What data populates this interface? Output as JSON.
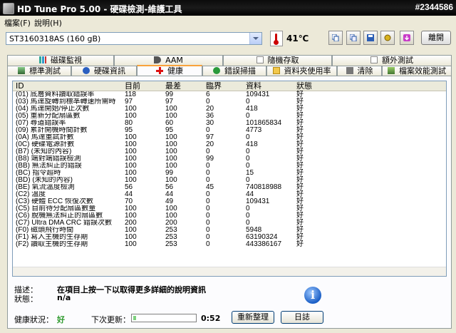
{
  "window": {
    "title": "HD Tune Pro  5.00 - 硬碟檢測-維護工具",
    "watermark": "#2344586"
  },
  "menu": [
    {
      "label": "檔案(F)"
    },
    {
      "label": "說明(H)"
    }
  ],
  "toolbar": {
    "drive": "ST3160318AS (160 gB)",
    "temperature": "41℃",
    "exit_label": "離開"
  },
  "tabs_top": [
    {
      "label": "磁碟監視"
    },
    {
      "label": "AAM"
    },
    {
      "label": "隨機存取"
    },
    {
      "label": "額外測試"
    }
  ],
  "tabs_bottom": [
    {
      "label": "標準測試"
    },
    {
      "label": "硬碟資訊"
    },
    {
      "label": "健康"
    },
    {
      "label": "錯誤掃描"
    },
    {
      "label": "資料夾使用率"
    },
    {
      "label": "清除"
    },
    {
      "label": "檔案效能測試"
    }
  ],
  "table": {
    "headers": [
      "ID",
      "目前",
      "最差",
      "臨界",
      "資料",
      "狀態"
    ],
    "rows": [
      [
        "(01) 底層資料讀取錯誤率",
        "118",
        "99",
        "6",
        "109431",
        "好"
      ],
      [
        "(03) 馬達旋轉到標準轉速所需時…",
        "97",
        "97",
        "0",
        "0",
        "好"
      ],
      [
        "(04) 馬達開始/停止次數",
        "100",
        "100",
        "20",
        "418",
        "好"
      ],
      [
        "(05) 重新分配扇區數",
        "100",
        "100",
        "36",
        "0",
        "好"
      ],
      [
        "(07) 尋道錯誤率",
        "80",
        "60",
        "30",
        "101865834",
        "好"
      ],
      [
        "(09) 累計開機時間計數",
        "95",
        "95",
        "0",
        "4773",
        "好"
      ],
      [
        "(0A) 馬達重試計數",
        "100",
        "100",
        "97",
        "0",
        "好"
      ],
      [
        "(0C) 硬碟電源計數",
        "100",
        "100",
        "20",
        "418",
        "好"
      ],
      [
        "(B7) (未知的內容)",
        "100",
        "100",
        "0",
        "0",
        "好"
      ],
      [
        "(B8) 端對端錯誤檢測",
        "100",
        "100",
        "99",
        "0",
        "好"
      ],
      [
        "(BB) 無法糾正的錯誤",
        "100",
        "100",
        "0",
        "0",
        "好"
      ],
      [
        "(BC) 指令超時",
        "100",
        "99",
        "0",
        "15",
        "好"
      ],
      [
        "(BD) (未知的內容)",
        "100",
        "100",
        "0",
        "0",
        "好"
      ],
      [
        "(BE) 氣流溫度檢測",
        "56",
        "56",
        "45",
        "740818988",
        "好"
      ],
      [
        "(C2) 溫度",
        "44",
        "44",
        "0",
        "44",
        "好"
      ],
      [
        "(C3) 硬體 ECC 恢復次數",
        "70",
        "49",
        "0",
        "109431",
        "好"
      ],
      [
        "(C5) 目前待分配扇區數量",
        "100",
        "100",
        "0",
        "0",
        "好"
      ],
      [
        "(C6) 脫機無法糾正的扇區數",
        "100",
        "100",
        "0",
        "0",
        "好"
      ],
      [
        "(C7) Ultra DMA CRC 錯誤次數",
        "200",
        "200",
        "0",
        "0",
        "好"
      ],
      [
        "(F0) 磁頭飛行時間",
        "100",
        "253",
        "0",
        "5948",
        "好"
      ],
      [
        "(F1) 寫入主機的生存期",
        "100",
        "253",
        "0",
        "63190324",
        "好"
      ],
      [
        "(F2) 讀取主機的生存期",
        "100",
        "253",
        "0",
        "443386167",
        "好"
      ]
    ]
  },
  "info": {
    "desc_label": "描述：",
    "desc_value": "在項目上按一下以取得更多詳細的說明資訊",
    "status_label": "狀態：",
    "status_value": "n/a"
  },
  "footer": {
    "health_label": "健康狀況：",
    "health_value": "好",
    "next_label": "下次更新：",
    "next_progress": 0.05,
    "timer": "0:52",
    "refresh_label": "重新整理",
    "log_label": "日誌"
  },
  "colors": {
    "health_ok": "#2e9a2e",
    "title_bg": "#000000",
    "tab_active_accent": "#f9a33c"
  }
}
